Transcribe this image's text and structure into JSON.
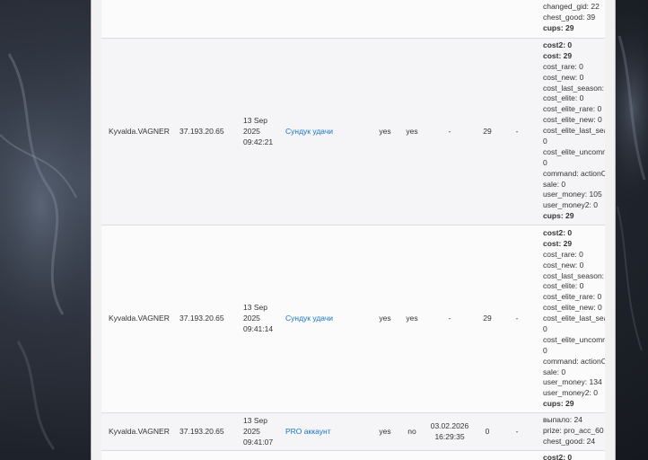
{
  "rows": [
    {
      "details": [
        {
          "text": "changed_gid: 22",
          "bold": false
        },
        {
          "text": "chest_good: 39",
          "bold": false
        },
        {
          "text": "cups: 29",
          "bold": true
        }
      ]
    },
    {
      "user": "Kyvalda.VAGNER",
      "ip": "37.193.20.65",
      "date": [
        "13 Sep",
        "2025",
        "09:42:21"
      ],
      "item": "Сундук удачи",
      "flag1": "yes",
      "flag2": "yes",
      "expires": "-",
      "cost": "29",
      "extra": "-",
      "details": [
        {
          "text": "cost2: 0",
          "bold": true
        },
        {
          "text": "cost: 29",
          "bold": true
        },
        {
          "text": "cost_rare: 0",
          "bold": false
        },
        {
          "text": "cost_new: 0",
          "bold": false
        },
        {
          "text": "cost_last_season: 0",
          "bold": false
        },
        {
          "text": "cost_elite: 0",
          "bold": false
        },
        {
          "text": "cost_elite_rare: 0",
          "bold": false
        },
        {
          "text": "cost_elite_new: 0",
          "bold": false
        },
        {
          "text": "cost_elite_last_season:",
          "bold": false
        },
        {
          "text": "0",
          "bold": false
        },
        {
          "text": "cost_elite_uncommon:",
          "bold": false
        },
        {
          "text": "0",
          "bold": false
        },
        {
          "text": "command: actionChest",
          "bold": false
        },
        {
          "text": "sale: 0",
          "bold": false
        },
        {
          "text": "user_money: 105",
          "bold": false
        },
        {
          "text": "user_money2: 0",
          "bold": false
        },
        {
          "text": "cups: 29",
          "bold": true
        }
      ]
    },
    {
      "user": "Kyvalda.VAGNER",
      "ip": "37.193.20.65",
      "date": [
        "13 Sep",
        "2025",
        "09:41:14"
      ],
      "item": "Сундук удачи",
      "flag1": "yes",
      "flag2": "yes",
      "expires": "-",
      "cost": "29",
      "extra": "-",
      "details": [
        {
          "text": "cost2: 0",
          "bold": true
        },
        {
          "text": "cost: 29",
          "bold": true
        },
        {
          "text": "cost_rare: 0",
          "bold": false
        },
        {
          "text": "cost_new: 0",
          "bold": false
        },
        {
          "text": "cost_last_season: 0",
          "bold": false
        },
        {
          "text": "cost_elite: 0",
          "bold": false
        },
        {
          "text": "cost_elite_rare: 0",
          "bold": false
        },
        {
          "text": "cost_elite_new: 0",
          "bold": false
        },
        {
          "text": "cost_elite_last_season:",
          "bold": false
        },
        {
          "text": "0",
          "bold": false
        },
        {
          "text": "cost_elite_uncommon:",
          "bold": false
        },
        {
          "text": "0",
          "bold": false
        },
        {
          "text": "command: actionChest",
          "bold": false
        },
        {
          "text": "sale: 0",
          "bold": false
        },
        {
          "text": "user_money: 134",
          "bold": false
        },
        {
          "text": "user_money2: 0",
          "bold": false
        },
        {
          "text": "cups: 29",
          "bold": true
        }
      ]
    },
    {
      "user": "Kyvalda.VAGNER",
      "ip": "37.193.20.65",
      "date": [
        "13 Sep",
        "2025",
        "09:41:07"
      ],
      "item": "PRO аккаунт",
      "flag1": "yes",
      "flag2": "no",
      "expires": [
        "03.02.2026",
        "16:29:35"
      ],
      "cost": "0",
      "extra": "-",
      "details": [
        {
          "text": "выпало: 24",
          "bold": false
        },
        {
          "text": "prize: pro_acc_60",
          "bold": false
        },
        {
          "text": "chest_good: 24",
          "bold": false
        }
      ]
    },
    {
      "details": [
        {
          "text": "cost2: 0",
          "bold": true
        }
      ]
    }
  ]
}
